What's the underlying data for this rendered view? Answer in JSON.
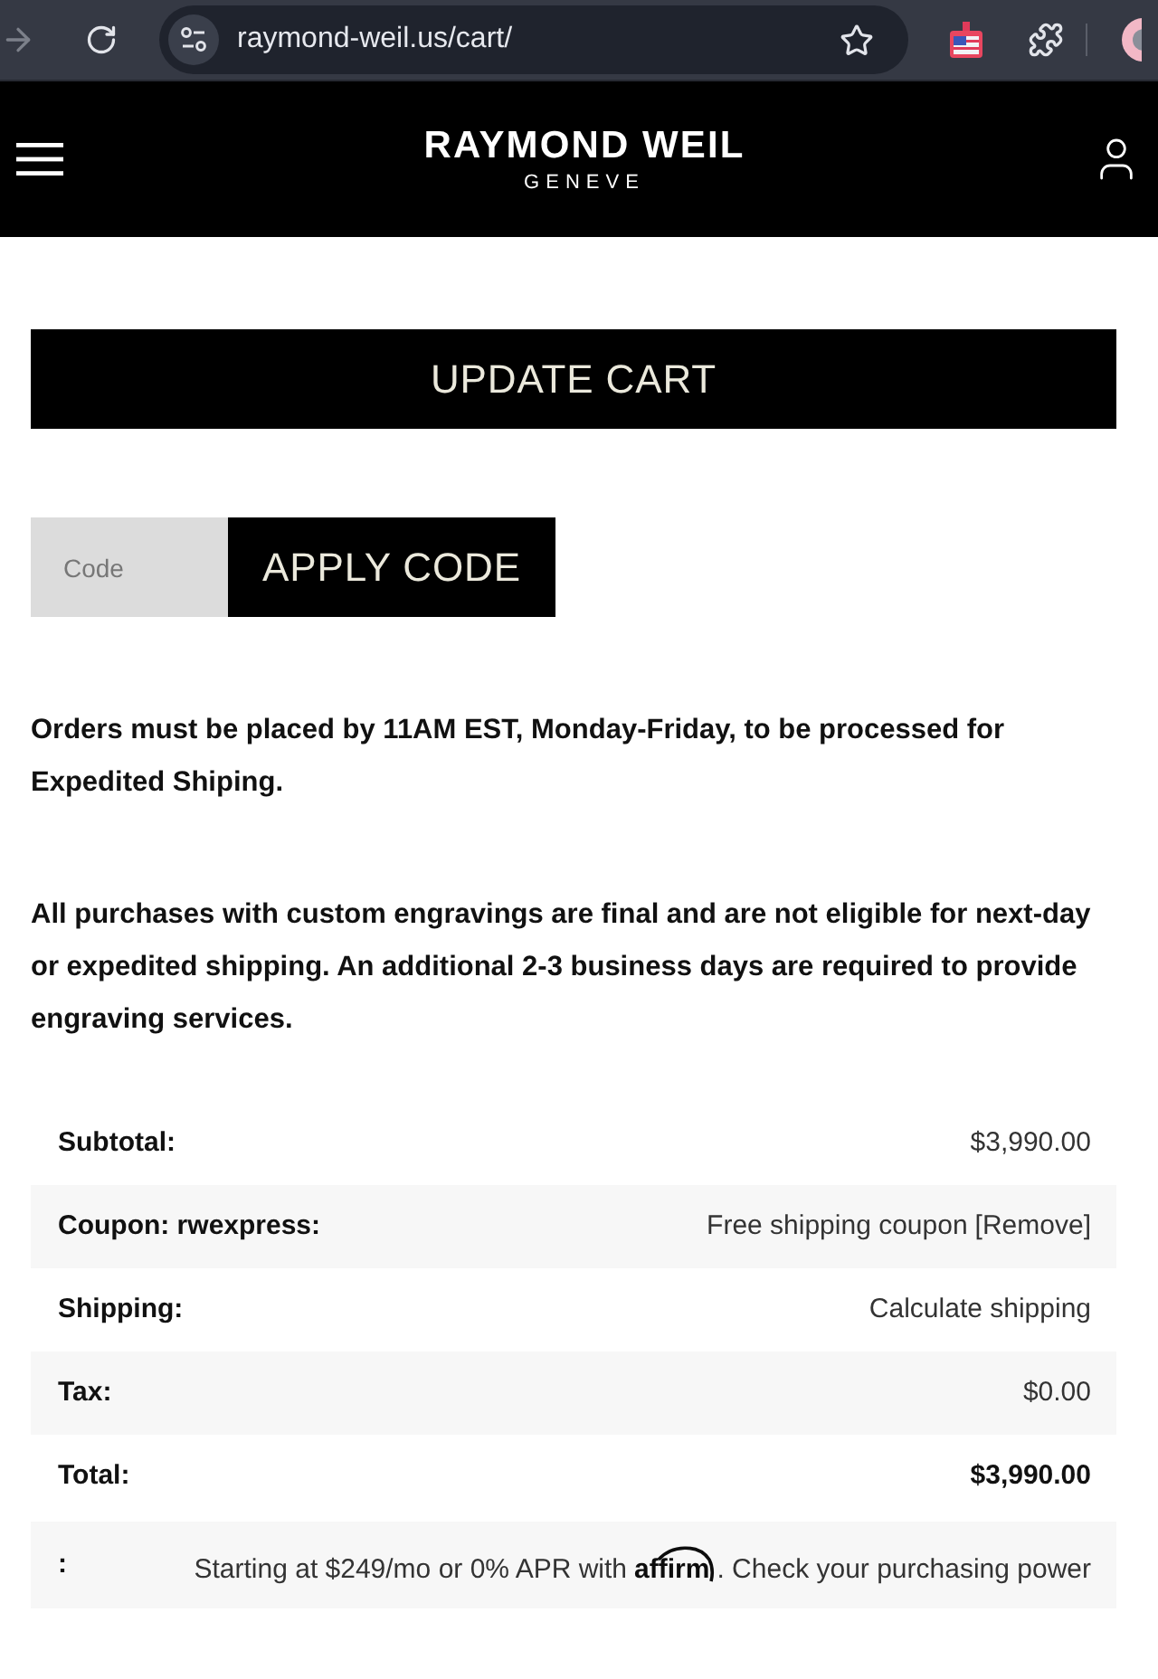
{
  "browser": {
    "url": "raymond-weil.us/cart/",
    "forward_disabled": true
  },
  "header": {
    "brand": "RAYMOND WEIL",
    "brand_sub": "GENEVE"
  },
  "cart_actions": {
    "update_button": "UPDATE CART",
    "coupon": {
      "placeholder": "Code",
      "apply_button": "APPLY CODE"
    }
  },
  "notices": [
    "Orders must be placed by 11AM EST, Monday-Friday, to be processed for Expedited Shiping.",
    "All purchases with custom engravings are final and are not eligible for next-day or expedited shipping. An additional 2-3 business days are required to provide engraving services."
  ],
  "totals": {
    "rows": [
      {
        "kind": "plain",
        "label": "Subtotal:",
        "value": "$3,990.00"
      },
      {
        "kind": "coupon",
        "label": "Coupon: rwexpress:",
        "value": "Free shipping coupon",
        "link": "[Remove]"
      },
      {
        "kind": "link",
        "label": "Shipping:",
        "value": "Calculate shipping"
      },
      {
        "kind": "plain",
        "label": "Tax:",
        "value": "$0.00"
      },
      {
        "kind": "total",
        "label": "Total:",
        "value": "$3,990.00"
      },
      {
        "kind": "financing",
        "label": ":",
        "text_before": "Starting at $249/mo or 0% APR with",
        "logo": "affirm",
        "text_after": ". Check your purchasing power"
      }
    ]
  }
}
